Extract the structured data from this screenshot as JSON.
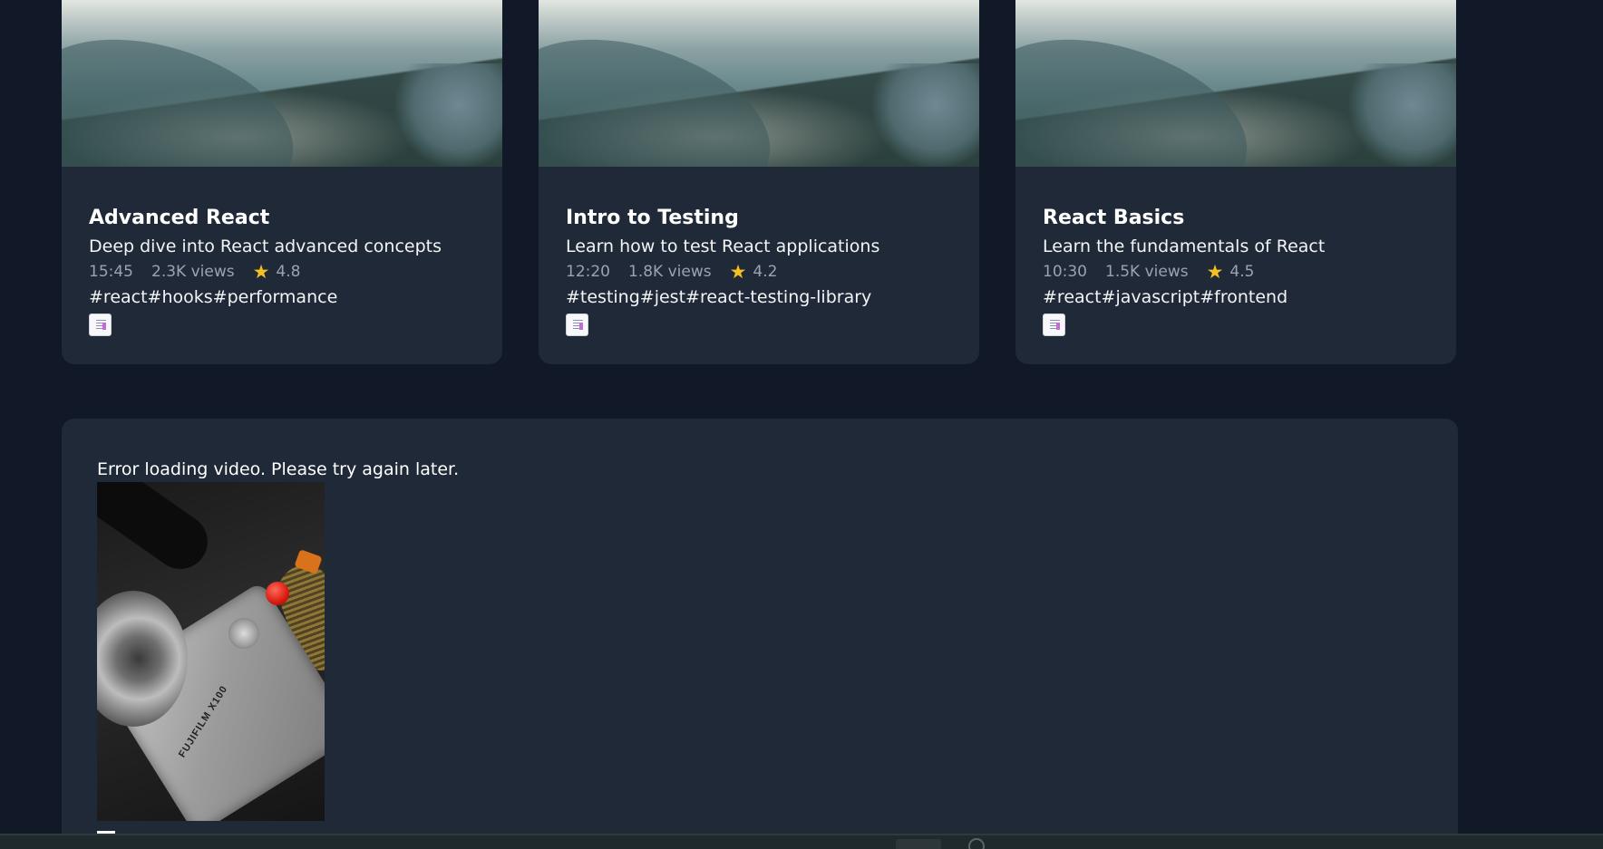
{
  "videos": [
    {
      "title": "Advanced React",
      "description": "Deep dive into React advanced concepts",
      "duration": "15:45",
      "views": "2.3K views",
      "rating": "4.8",
      "tags": "#react#hooks#performance"
    },
    {
      "title": "Intro to Testing",
      "description": "Learn how to test React applications",
      "duration": "12:20",
      "views": "1.8K views",
      "rating": "4.2",
      "tags": "#testing#jest#react-testing-library"
    },
    {
      "title": "React Basics",
      "description": "Learn the fundamentals of React",
      "duration": "10:30",
      "views": "1.5K views",
      "rating": "4.5",
      "tags": "#react#javascript#frontend"
    }
  ],
  "player": {
    "error_message": "Error loading video. Please try again later.",
    "poster_label": "FUJIFILM X100"
  },
  "icons": {
    "star": "star-icon",
    "broken_image": "broken-image-icon"
  },
  "colors": {
    "page_bg": "#111827",
    "card_bg": "#1f2937",
    "star": "#f5c023",
    "muted_text": "#9ca3af"
  }
}
